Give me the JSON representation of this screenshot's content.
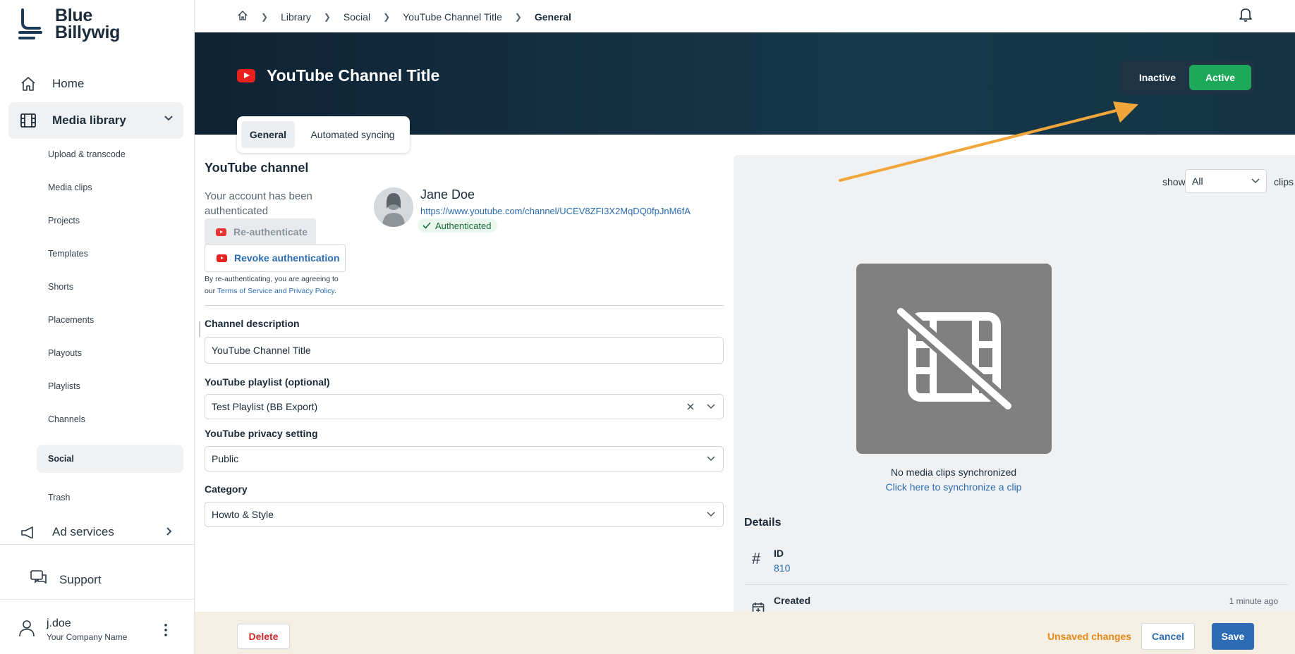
{
  "brand": {
    "line1": "Blue",
    "line2": "Billywig"
  },
  "sidebar": {
    "main": [
      {
        "label": "Home",
        "icon": "home-icon"
      },
      {
        "label": "Media library",
        "icon": "film-icon"
      },
      {
        "label": "Ad services",
        "icon": "megaphone-icon"
      },
      {
        "label": "Support",
        "icon": "chat-icon"
      }
    ],
    "sub": [
      "Upload & transcode",
      "Media clips",
      "Projects",
      "Templates",
      "Shorts",
      "Placements",
      "Playouts",
      "Playlists",
      "Channels",
      "Social",
      "Trash"
    ],
    "user": {
      "name": "j.doe",
      "company": "Your Company Name"
    }
  },
  "breadcrumb": [
    "Library",
    "Social",
    "YouTube Channel Title",
    "General"
  ],
  "header": {
    "title": "YouTube Channel Title",
    "toggle": {
      "inactive": "Inactive",
      "active": "Active",
      "selected": "Active"
    }
  },
  "tabs": [
    "General",
    "Automated syncing"
  ],
  "channel": {
    "heading": "YouTube channel",
    "auth_note": "Your account has been authenticated",
    "reauth_label": "Re-authenticate",
    "revoke_label": "Revoke authentication",
    "terms_prefix": "By re-authenticating, you are agreeing to our",
    "terms_link": "Terms of Service and Privacy Policy",
    "terms_suffix": ".",
    "profile_name": "Jane Doe",
    "profile_url": "https://www.youtube.com/channel/UCEV8ZFI3X2MqDQ0fpJnM6fA",
    "status": "Authenticated"
  },
  "form": {
    "description": {
      "label": "Channel description",
      "value": "YouTube Channel Title"
    },
    "playlist": {
      "label": "YouTube playlist (optional)",
      "value": "Test Playlist (BB Export)"
    },
    "privacy": {
      "label": "YouTube privacy setting",
      "value": "Public"
    },
    "category": {
      "label": "Category",
      "value": "Howto & Style"
    }
  },
  "clips": {
    "show_label": "show",
    "filter_value": "All",
    "clips_label": "clips",
    "empty_text": "No media clips synchronized",
    "sync_link": "Click here to synchronize a clip"
  },
  "details": {
    "heading": "Details",
    "id_label": "ID",
    "id_value": "810",
    "created_label": "Created",
    "created_time": "1 minute ago"
  },
  "footer": {
    "delete": "Delete",
    "unsaved": "Unsaved changes",
    "cancel": "Cancel",
    "save": "Save"
  },
  "colors": {
    "accent": "#2d6cb4",
    "active_green": "#1ea85a",
    "youtube_red": "#e8211f",
    "header_bg": "#0f2233",
    "warning": "#e6891a",
    "danger": "#d12a2a"
  }
}
